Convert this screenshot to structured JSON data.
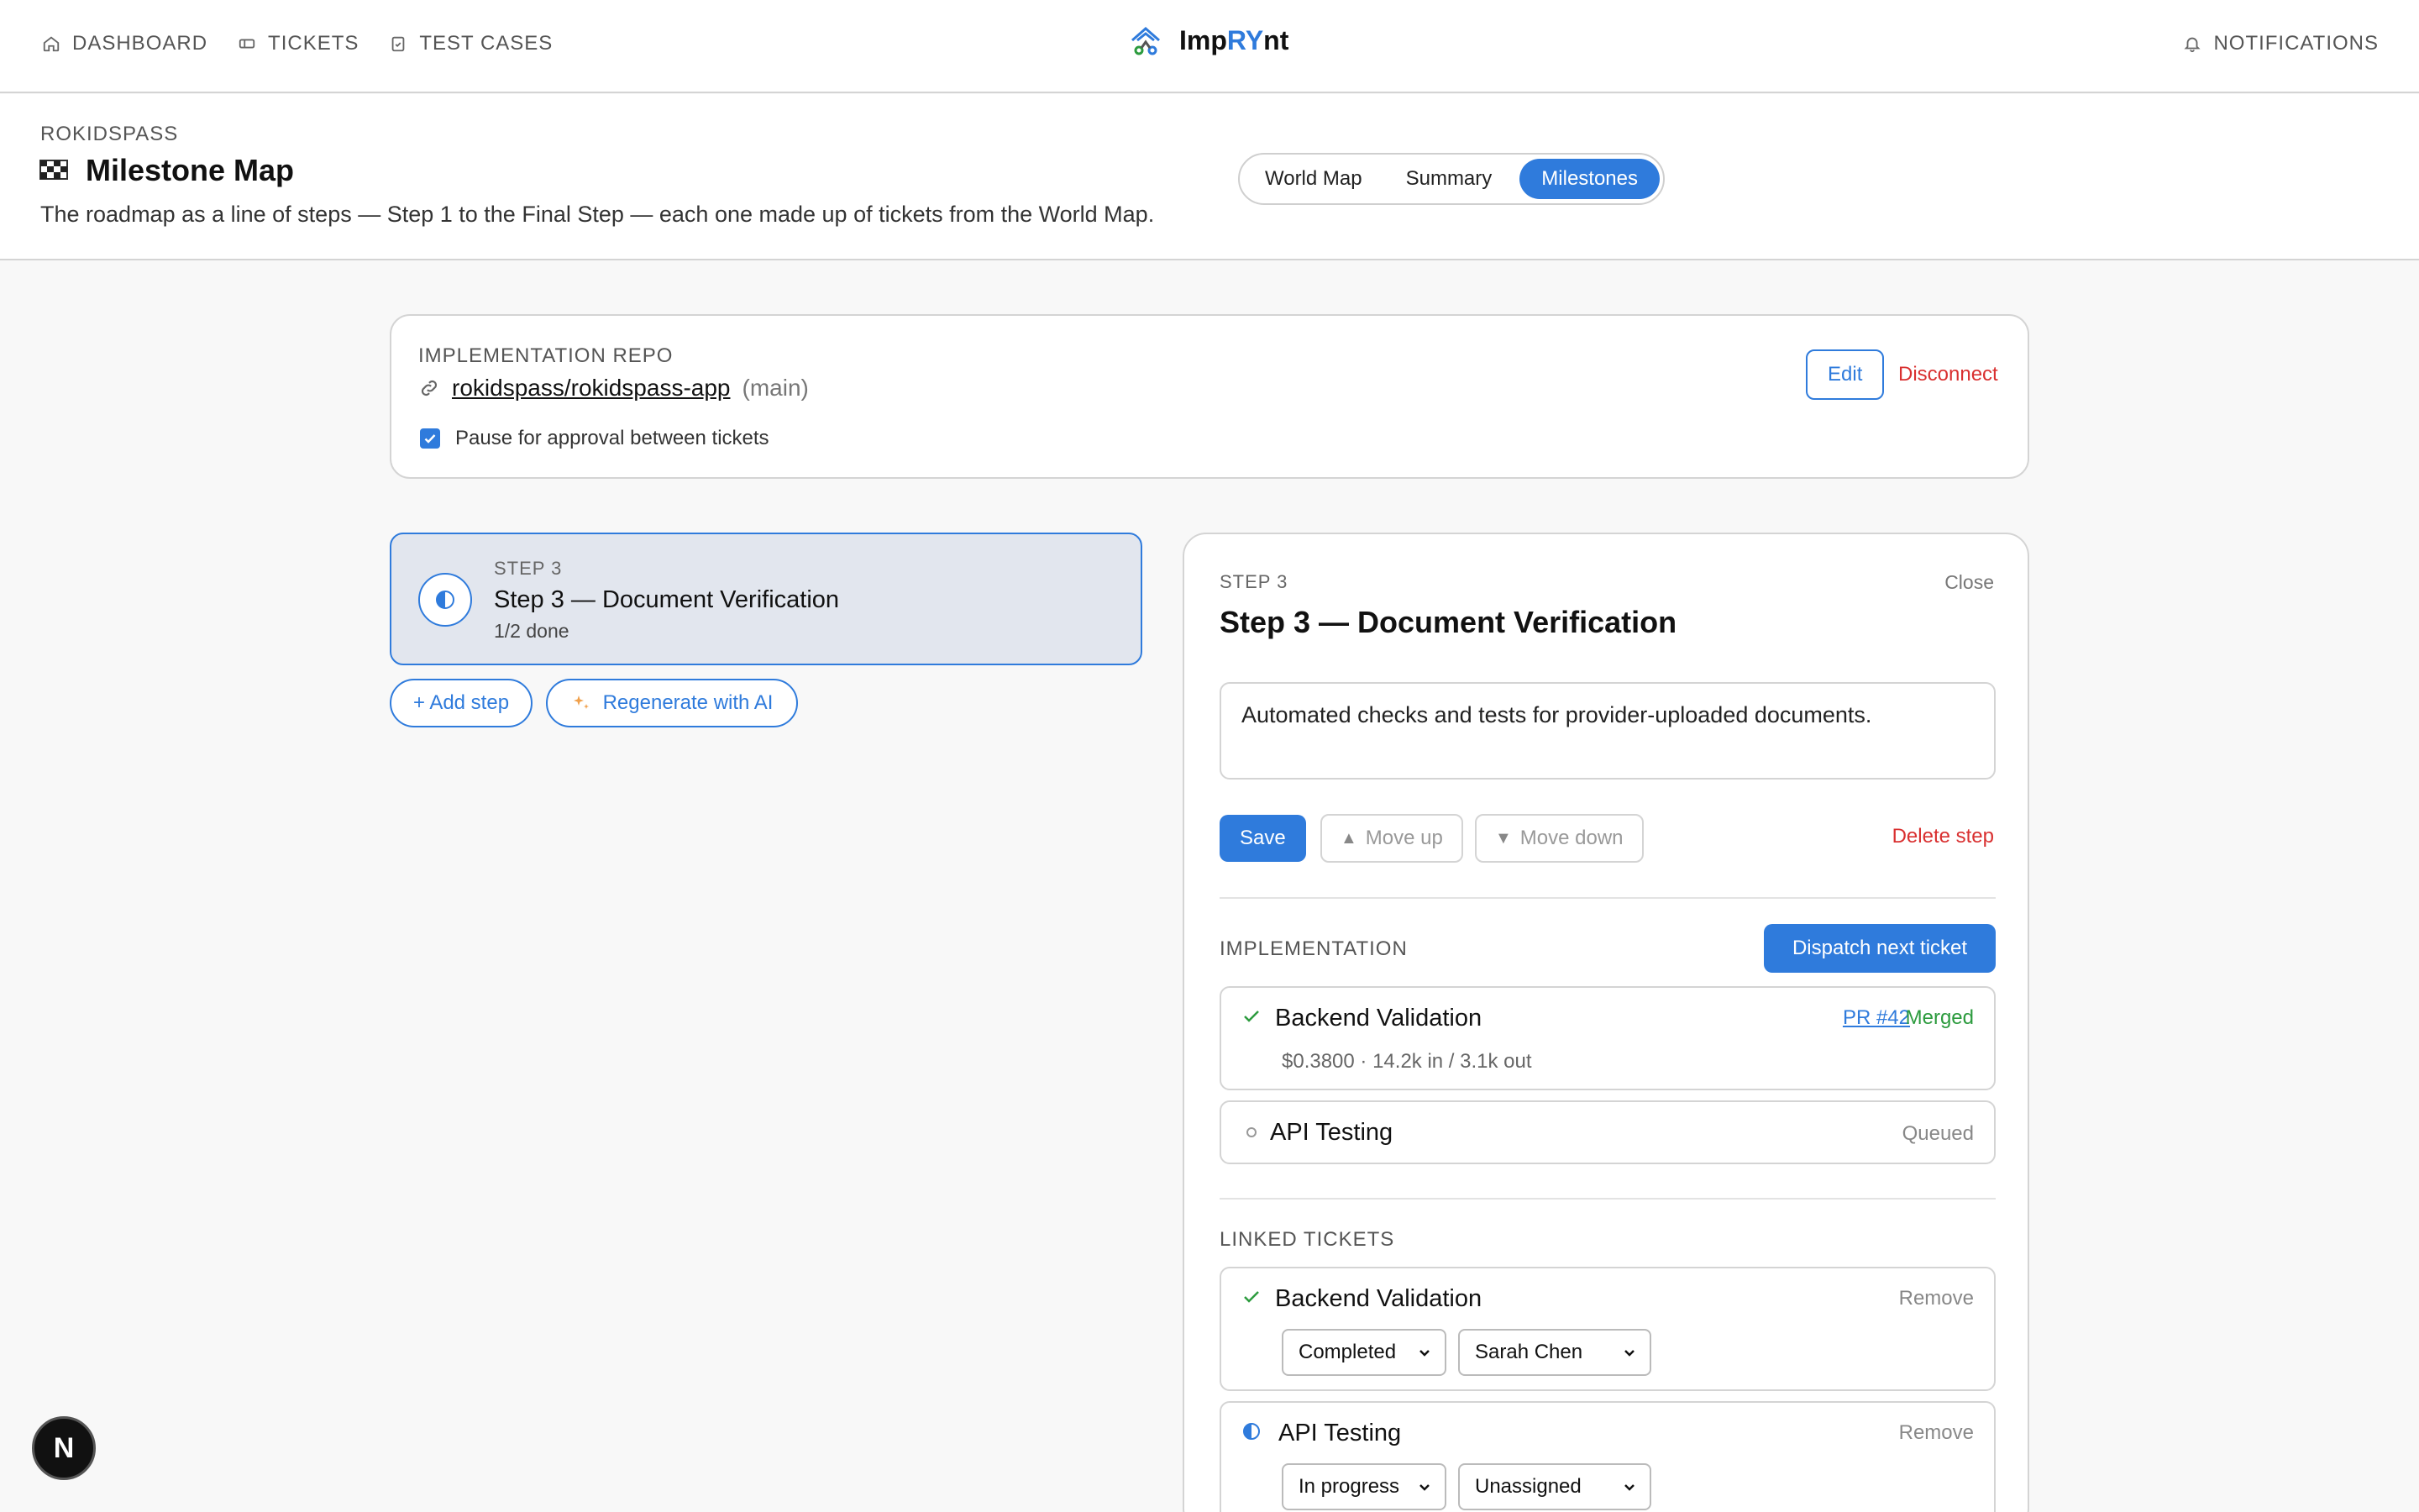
{
  "nav": {
    "items": [
      {
        "label": "DASHBOARD",
        "icon": "home-icon"
      },
      {
        "label": "TICKETS",
        "icon": "ticket-icon"
      },
      {
        "label": "TEST CASES",
        "icon": "clipboard-check-icon"
      }
    ],
    "brand": {
      "part1": "Imp",
      "part2": "RY",
      "part3": "nt"
    },
    "notifications": "NOTIFICATIONS"
  },
  "header": {
    "project": "ROKIDSPASS",
    "title": "Milestone Map",
    "description": "The roadmap as a line of steps — Step 1 to the Final Step — each one made up of tickets from the World Map.",
    "views": [
      "World Map",
      "Summary",
      "Milestones"
    ],
    "active_view": "Milestones"
  },
  "repo": {
    "label": "IMPLEMENTATION REPO",
    "name": "rokidspass/rokidspass-app",
    "branch": "(main)",
    "pause_label": "Pause for approval between tickets",
    "pause_checked": true,
    "edit_label": "Edit",
    "disconnect_label": "Disconnect"
  },
  "steps": [
    {
      "kicker": "STEP 3",
      "name": "Step 3 — Document Verification",
      "progress": "1/2 done"
    }
  ],
  "step_actions": {
    "add": "+ Add step",
    "regenerate": "Regenerate with AI"
  },
  "detail": {
    "kicker": "STEP 3",
    "close": "Close",
    "title": "Step 3 — Document Verification",
    "description": "Automated checks and tests for provider-uploaded documents.",
    "save": "Save",
    "move_up": "Move up",
    "move_down": "Move down",
    "delete": "Delete step",
    "implementation_label": "IMPLEMENTATION",
    "dispatch": "Dispatch next ticket",
    "implementation": [
      {
        "title": "Backend Validation",
        "pr": "PR #42",
        "status": "Merged",
        "meta": "$0.3800 · 14.2k in / 3.1k out"
      },
      {
        "title": "API Testing",
        "status": "Queued"
      }
    ],
    "linked_label": "LINKED TICKETS",
    "linked": [
      {
        "title": "Backend Validation",
        "remove": "Remove",
        "state": "Completed",
        "assignee": "Sarah Chen"
      },
      {
        "title": "API Testing",
        "remove": "Remove",
        "state": "In progress",
        "assignee": "Unassigned"
      }
    ]
  },
  "badge": "N",
  "colors": {
    "accent": "#2f7bdc",
    "danger": "#d93030",
    "success": "#2c9b3e"
  }
}
